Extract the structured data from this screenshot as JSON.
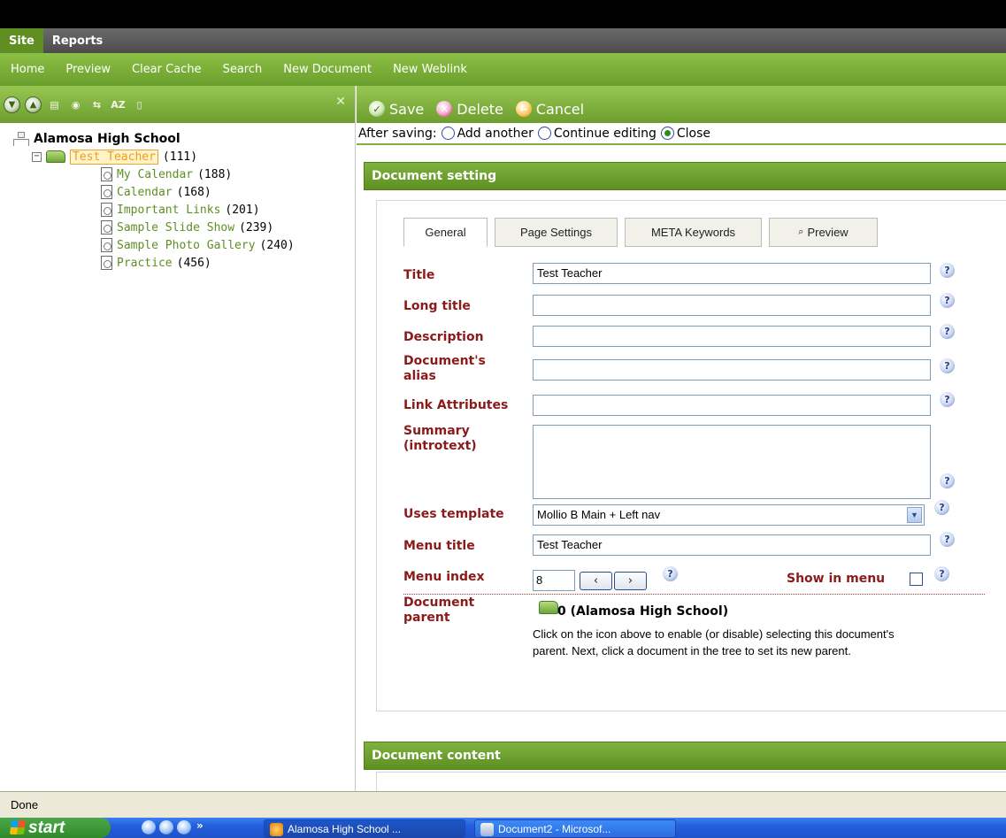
{
  "tabs": [
    "Site",
    "Reports"
  ],
  "menu": [
    "Home",
    "Preview",
    "Clear Cache",
    "Search",
    "New Document",
    "New Weblink"
  ],
  "tree": {
    "root": "Alamosa High School",
    "selected": {
      "label": "Test Teacher",
      "count": "(111)"
    },
    "children": [
      {
        "label": "My Calendar",
        "count": "(188)"
      },
      {
        "label": "Calendar",
        "count": "(168)"
      },
      {
        "label": "Important Links",
        "count": "(201)"
      },
      {
        "label": "Sample Slide Show",
        "count": "(239)"
      },
      {
        "label": "Sample Photo Gallery",
        "count": "(240)"
      },
      {
        "label": "Practice",
        "count": "(456)"
      }
    ]
  },
  "left_toolbar": {
    "sort_label": "AZ",
    "icons": [
      "expand-icon",
      "collapse-icon",
      "new-document-icon",
      "new-weblink-icon",
      "purge-icon",
      "sort-icon",
      "trash-icon",
      "close-icon"
    ]
  },
  "actions": {
    "save": "Save",
    "delete": "Delete",
    "cancel": "Cancel"
  },
  "after_saving": {
    "label": "After saving:",
    "options": [
      "Add another",
      "Continue editing",
      "Close"
    ],
    "selected": "Close"
  },
  "sections": {
    "settings": "Document setting",
    "content": "Document content"
  },
  "form_tabs": [
    "General",
    "Page Settings",
    "META Keywords",
    "Preview"
  ],
  "form": {
    "title_label": "Title",
    "title_value": "Test Teacher",
    "long_title_label": "Long title",
    "description_label": "Description",
    "alias_label_1": "Document's",
    "alias_label_2": "alias",
    "link_attr_label": "Link Attributes",
    "summary_label_1": "Summary",
    "summary_label_2": "(introtext)",
    "template_label": "Uses template",
    "template_value": "Mollio B Main + Left nav",
    "menu_title_label": "Menu title",
    "menu_title_value": "Test Teacher",
    "menu_index_label": "Menu index",
    "menu_index_value": "8",
    "show_in_menu_label": "Show in menu",
    "parent_label_1": "Document",
    "parent_label_2": "parent",
    "parent_value": "0 (Alamosa High School)",
    "parent_help": "Click on the icon above to enable (or disable) selecting this document's parent. Next, click a document in the tree to set its new parent.",
    "help_glyph": "?"
  },
  "status": "Done",
  "taskbar": {
    "start": "start",
    "more": "»",
    "items": [
      "Alamosa High School ...",
      "Document2 - Microsof..."
    ]
  },
  "colors": {
    "green": "#6c9e2e",
    "label_red": "#8b1a1a",
    "tree_green": "#5f8f22",
    "selected_orange": "#f39a1b"
  }
}
